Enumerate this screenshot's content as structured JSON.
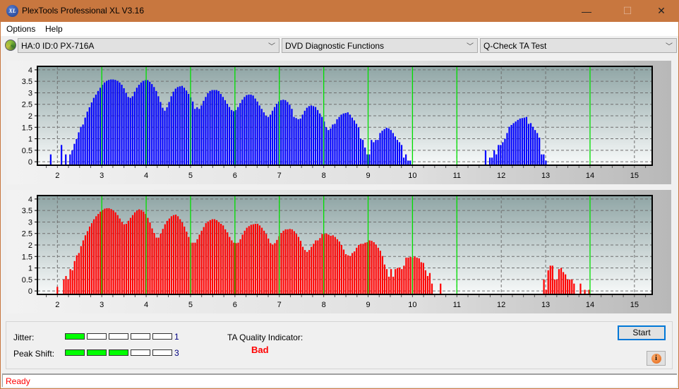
{
  "window": {
    "title": "PlexTools Professional XL V3.16",
    "icon": "xl-logo-icon",
    "controls": {
      "minimize": "—",
      "maximize": "☐",
      "close": "✕"
    }
  },
  "menu": {
    "items": [
      "Options",
      "Help"
    ]
  },
  "toolbar": {
    "drive": "HA:0 ID:0  PX-716A",
    "function": "DVD Diagnostic Functions",
    "test": "Q-Check TA Test",
    "chevron": "﹀"
  },
  "colors": {
    "top_bars": "#0000ff",
    "bottom_bars": "#ff0000",
    "marker_lines": "#00e000",
    "quality_bad": "#ff0000",
    "meter_on": "#00ff00"
  },
  "chart_data": [
    {
      "type": "bar",
      "name": "top-chart",
      "title": "",
      "xlabel": "",
      "ylabel": "",
      "xlim": [
        1.55,
        15.4
      ],
      "ylim": [
        -0.15,
        4.15
      ],
      "xticks": [
        2,
        3,
        4,
        5,
        6,
        7,
        8,
        9,
        10,
        11,
        12,
        13,
        14,
        15
      ],
      "yticks": [
        0,
        0.5,
        1,
        1.5,
        2,
        2.5,
        3,
        3.5,
        4
      ],
      "ytick_labels": [
        "0",
        "0.5",
        "1",
        "1.5",
        "2",
        "2.5",
        "3",
        "3.5",
        "4"
      ],
      "markers": [
        3,
        4,
        5,
        6,
        7,
        8,
        9,
        10,
        11,
        14
      ],
      "grid": true,
      "x_start": 1.85,
      "x_step": 0.0485,
      "values": [
        0.32,
        0,
        0,
        0,
        0,
        0.73,
        0,
        0.32,
        0,
        0.32,
        0.5,
        0.78,
        0.99,
        1.28,
        1.52,
        1.62,
        1.92,
        2.18,
        2.37,
        2.58,
        2.78,
        2.92,
        3.08,
        3.22,
        3.35,
        3.45,
        3.52,
        3.56,
        3.58,
        3.58,
        3.56,
        3.52,
        3.45,
        3.35,
        3.2,
        3.0,
        2.82,
        2.78,
        2.85,
        3.05,
        3.22,
        3.35,
        3.45,
        3.52,
        3.55,
        3.55,
        3.48,
        3.38,
        3.25,
        3.08,
        2.85,
        2.6,
        2.35,
        2.22,
        2.37,
        2.6,
        2.85,
        3.05,
        3.18,
        3.25,
        3.28,
        3.3,
        3.22,
        3.1,
        2.95,
        2.8,
        2.62,
        2.3,
        2.37,
        2.3,
        2.45,
        2.65,
        2.82,
        2.98,
        3.08,
        3.12,
        3.12,
        3.12,
        3.08,
        2.95,
        2.82,
        2.68,
        2.52,
        2.38,
        2.25,
        2.2,
        2.25,
        2.38,
        2.55,
        2.7,
        2.82,
        2.9,
        2.92,
        2.92,
        2.88,
        2.75,
        2.62,
        2.45,
        2.3,
        2.15,
        2.0,
        1.95,
        2.05,
        2.22,
        2.38,
        2.52,
        2.62,
        2.68,
        2.7,
        2.68,
        2.6,
        2.48,
        2.3,
        1.95,
        1.9,
        1.85,
        1.88,
        2.05,
        2.22,
        2.35,
        2.42,
        2.45,
        2.42,
        2.38,
        2.25,
        2.1,
        1.95,
        1.75,
        1.5,
        1.38,
        1.45,
        1.62,
        1.65,
        1.85,
        1.95,
        2.05,
        2.1,
        2.12,
        2.15,
        2.05,
        1.92,
        1.8,
        1.65,
        1.5,
        1.0,
        0.95,
        0.62,
        0.32,
        0.32,
        0.95,
        0.85,
        0.95,
        0.95,
        1.25,
        1.35,
        1.42,
        1.48,
        1.45,
        1.38,
        1.25,
        1.1,
        0.95,
        0.85,
        0.73,
        0.18,
        0.32,
        0.05,
        0.05,
        0,
        0,
        0,
        0,
        0,
        0,
        0,
        0,
        0,
        0,
        0,
        0,
        0,
        0,
        0,
        0,
        0,
        0,
        0,
        0,
        0,
        0,
        0,
        0,
        0,
        0,
        0,
        0,
        0,
        0,
        0,
        0,
        0,
        0,
        0.5,
        0,
        0.18,
        0.18,
        0.5,
        0.32,
        0.73,
        0.73,
        0.85,
        1.0,
        1.25,
        1.52,
        1.6,
        1.68,
        1.75,
        1.82,
        1.88,
        1.9,
        1.92,
        1.95,
        1.65,
        1.68,
        1.52,
        1.38,
        1.25,
        1.05,
        0.32,
        0.32,
        0.05
      ],
      "values_note": "bar heights in y units, consecutive bars at x_start + i*x_step"
    },
    {
      "type": "bar",
      "name": "bottom-chart",
      "title": "",
      "xlabel": "",
      "ylabel": "",
      "xlim": [
        1.55,
        15.4
      ],
      "ylim": [
        -0.15,
        4.15
      ],
      "xticks": [
        2,
        3,
        4,
        5,
        6,
        7,
        8,
        9,
        10,
        11,
        12,
        13,
        14,
        15
      ],
      "yticks": [
        0,
        0.5,
        1,
        1.5,
        2,
        2.5,
        3,
        3.5,
        4
      ],
      "ytick_labels": [
        "0",
        "0.5",
        "1",
        "1.5",
        "2",
        "2.5",
        "3",
        "3.5",
        "4"
      ],
      "markers": [
        3,
        4,
        5,
        6,
        7,
        8,
        9,
        10,
        11,
        14
      ],
      "grid": true,
      "x_start": 2.0,
      "x_step": 0.0485,
      "values": [
        0.18,
        0,
        0,
        0.5,
        0.65,
        0.5,
        0.95,
        0.9,
        1.3,
        1.55,
        1.65,
        1.95,
        2.2,
        2.42,
        2.6,
        2.8,
        2.95,
        3.12,
        3.25,
        3.35,
        3.45,
        3.52,
        3.58,
        3.6,
        3.6,
        3.56,
        3.5,
        3.42,
        3.3,
        3.15,
        3.0,
        2.9,
        2.92,
        3.05,
        3.18,
        3.3,
        3.42,
        3.5,
        3.55,
        3.52,
        3.45,
        3.35,
        3.18,
        2.98,
        2.72,
        2.52,
        2.32,
        2.32,
        2.5,
        2.7,
        2.9,
        3.05,
        3.15,
        3.25,
        3.3,
        3.32,
        3.25,
        3.12,
        2.98,
        2.8,
        2.58,
        2.35,
        2.1,
        2.1,
        2.1,
        2.25,
        2.45,
        2.62,
        2.78,
        2.95,
        3.02,
        3.08,
        3.12,
        3.12,
        3.08,
        3.0,
        2.92,
        2.85,
        2.68,
        2.55,
        2.35,
        2.2,
        2.1,
        2.08,
        2.1,
        2.25,
        2.45,
        2.62,
        2.75,
        2.82,
        2.88,
        2.9,
        2.92,
        2.92,
        2.85,
        2.75,
        2.62,
        2.48,
        2.28,
        2.08,
        2.02,
        2.08,
        2.22,
        2.38,
        2.52,
        2.62,
        2.68,
        2.68,
        2.7,
        2.68,
        2.6,
        2.48,
        2.35,
        2.18,
        1.92,
        1.78,
        1.7,
        1.78,
        1.92,
        2.05,
        2.2,
        2.2,
        2.3,
        2.48,
        2.48,
        2.5,
        2.45,
        2.4,
        2.42,
        2.35,
        2.25,
        2.15,
        2.0,
        1.8,
        1.6,
        1.55,
        1.52,
        1.65,
        1.72,
        1.88,
        2.0,
        2.05,
        2.05,
        2.1,
        2.12,
        2.2,
        2.18,
        2.12,
        2.02,
        1.88,
        1.75,
        1.52,
        1.15,
        0.95,
        0.62,
        0.95,
        0.62,
        0.95,
        1.0,
        1.02,
        0.95,
        1.1,
        1.45,
        1.45,
        1.48,
        1.45,
        1.5,
        1.45,
        1.42,
        1.25,
        1.22,
        0.9,
        0.65,
        0.78,
        0.32,
        0,
        0,
        0,
        0.32,
        0,
        0,
        0,
        0,
        0,
        0,
        0,
        0,
        0,
        0,
        0,
        0,
        0,
        0,
        0,
        0,
        0,
        0,
        0,
        0,
        0,
        0,
        0,
        0,
        0,
        0,
        0,
        0,
        0,
        0,
        0,
        0,
        0,
        0,
        0,
        0,
        0,
        0,
        0,
        0,
        0,
        0,
        0,
        0,
        0,
        0,
        0,
        0.5,
        0.05,
        0.9,
        1.1,
        1.1,
        0.5,
        0.5,
        0.95,
        1.0,
        0.82,
        0.72,
        0.5,
        0.5,
        0.5,
        0.32,
        0,
        0,
        0.32,
        0,
        0.05,
        0,
        0.05,
        0
      ],
      "values_note": "bar heights in y units, consecutive bars at x_start + i*x_step"
    }
  ],
  "results": {
    "jitter_label": "Jitter:",
    "jitter_value": "1",
    "jitter_level": 1,
    "peak_shift_label": "Peak Shift:",
    "peak_shift_value": "3",
    "peak_shift_level": 3,
    "meter_max": 5,
    "quality_label": "TA Quality Indicator:",
    "quality_value": "Bad"
  },
  "buttons": {
    "start": "Start",
    "info": "i"
  },
  "status": {
    "text": "Ready"
  }
}
